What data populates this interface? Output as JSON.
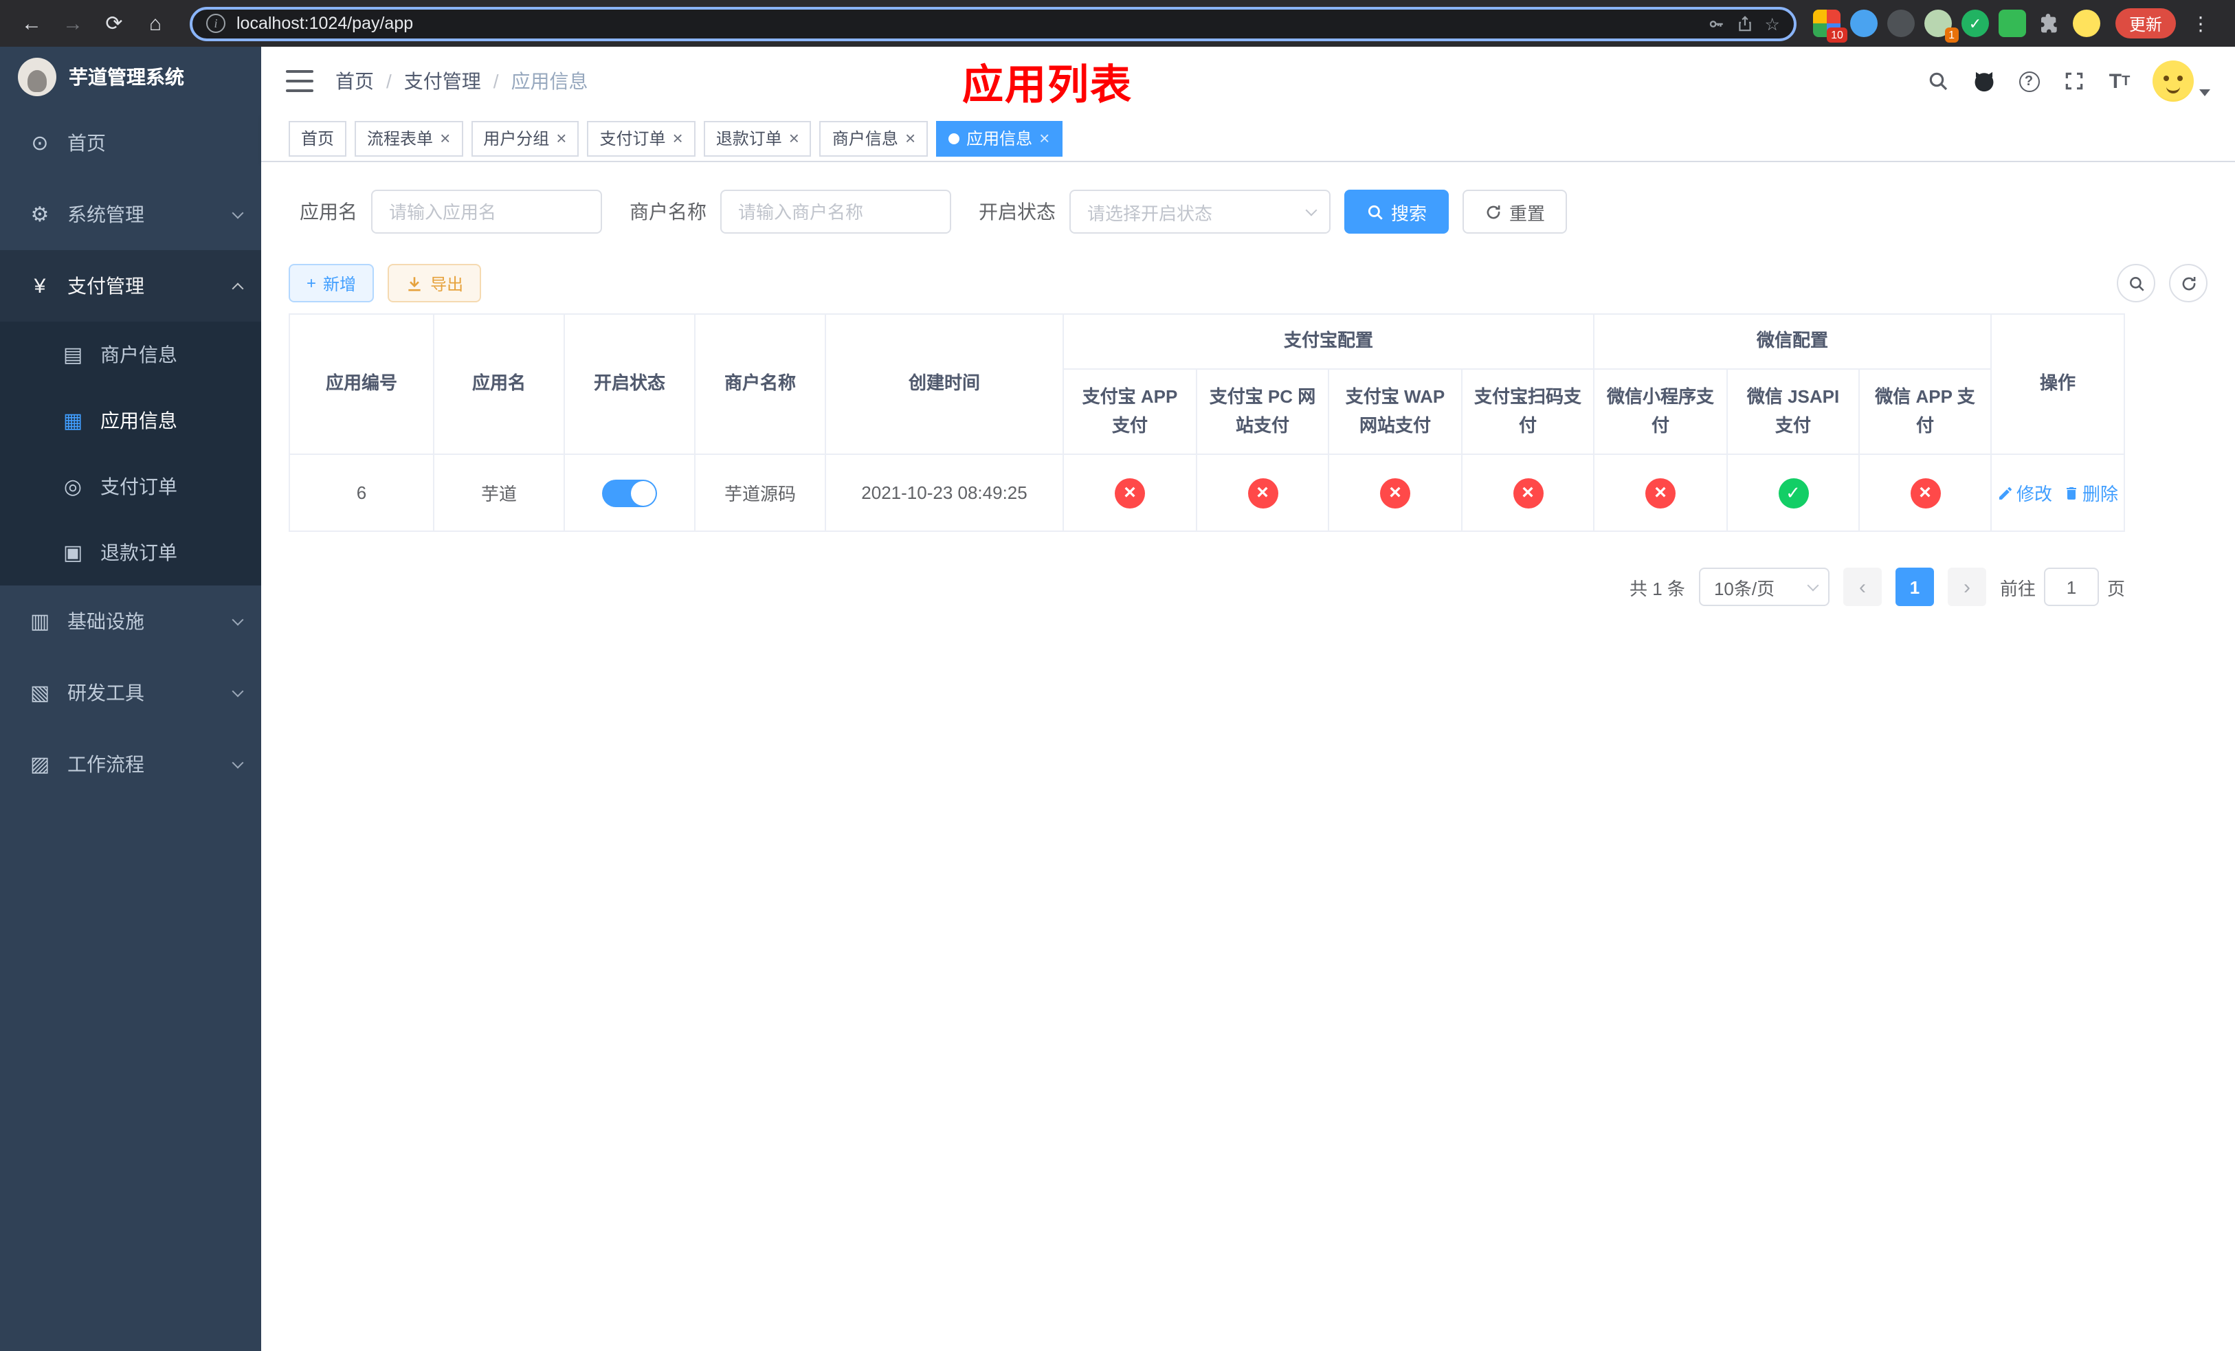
{
  "browser": {
    "url": "localhost:1024/pay/app",
    "update_label": "更新",
    "ext_badge_a": "10",
    "ext_badge_b": "1"
  },
  "icons": {
    "dashboard": "⊙",
    "gear": "⚙",
    "yen": "¥",
    "card": "▤",
    "grid": "▦",
    "order": "◎",
    "refund": "▣",
    "infra": "▥",
    "tools": "▧",
    "flow": "▨",
    "star": "☆",
    "more": "⋮",
    "plus": "+"
  },
  "sidebar": {
    "title": "芋道管理系统",
    "home": "首页",
    "system": "系统管理",
    "payment": "支付管理",
    "merchant_info": "商户信息",
    "app_info": "应用信息",
    "pay_order": "支付订单",
    "refund_order": "退款订单",
    "infrastructure": "基础设施",
    "dev_tools": "研发工具",
    "workflow": "工作流程"
  },
  "header": {
    "breadcrumb_home": "首页",
    "breadcrumb_payment": "支付管理",
    "breadcrumb_current": "应用信息",
    "page_title": "应用列表"
  },
  "tabs": [
    {
      "label": "首页"
    },
    {
      "label": "流程表单"
    },
    {
      "label": "用户分组"
    },
    {
      "label": "支付订单"
    },
    {
      "label": "退款订单"
    },
    {
      "label": "商户信息"
    },
    {
      "label": "应用信息"
    }
  ],
  "filters": {
    "app_name_label": "应用名",
    "app_name_placeholder": "请输入应用名",
    "merchant_label": "商户名称",
    "merchant_placeholder": "请输入商户名称",
    "status_label": "开启状态",
    "status_placeholder": "请选择开启状态",
    "search_label": "搜索",
    "reset_label": "重置"
  },
  "toolbar": {
    "add_label": "新增",
    "export_label": "导出"
  },
  "table": {
    "col_id": "应用编号",
    "col_name": "应用名",
    "col_status": "开启状态",
    "col_merchant": "商户名称",
    "col_created": "创建时间",
    "group_alipay": "支付宝配置",
    "group_wechat": "微信配置",
    "col_alipay_app": "支付宝 APP 支付",
    "col_alipay_pc": "支付宝 PC 网站支付",
    "col_alipay_wap": "支付宝 WAP 网站支付",
    "col_alipay_qr": "支付宝扫码支付",
    "col_wx_lite": "微信小程序支付",
    "col_wx_jsapi": "微信 JSAPI 支付",
    "col_wx_app": "微信 APP 支付",
    "col_actions": "操作",
    "row": {
      "id": "6",
      "name": "芋道",
      "status_on": "on",
      "merchant": "芋道源码",
      "created": "2021-10-23 08:49:25",
      "alipay_app": "no",
      "alipay_pc": "no",
      "alipay_wap": "no",
      "alipay_qr": "no",
      "wx_lite": "no",
      "wx_jsapi": "yes",
      "wx_app": "no",
      "edit_label": "修改",
      "delete_label": "删除"
    }
  },
  "pagination": {
    "total": "共 1 条",
    "page_size": "10条/页",
    "prev": "‹",
    "next": "›",
    "current_page": "1",
    "goto_label": "前往",
    "goto_value": "1",
    "goto_unit": "页"
  },
  "colors": {
    "primary": "#409eff",
    "success": "#13ce66",
    "danger": "#ff4949",
    "warning": "#e6a23c",
    "title_red": "#ff0000"
  }
}
